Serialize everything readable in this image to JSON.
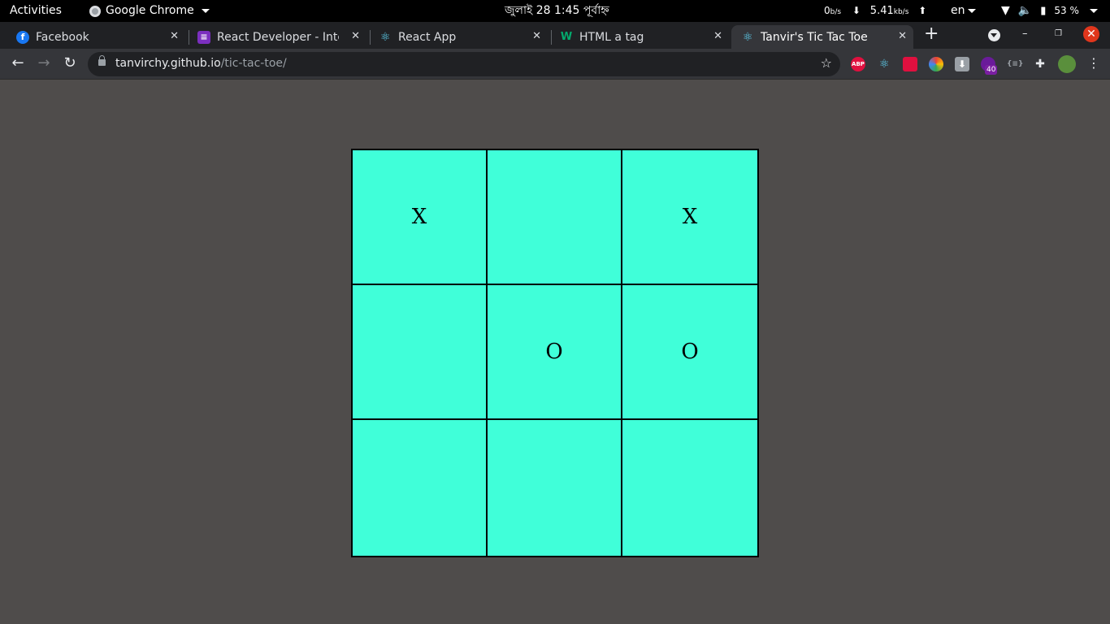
{
  "system_bar": {
    "activities": "Activities",
    "app_name": "Google Chrome",
    "clock": "জুলাই 28   1:45 পূর্বাহ্ন",
    "net_down_value": "0",
    "net_down_unit": "b/s",
    "net_up_value": "5.41",
    "net_up_unit": "kb/s",
    "language": "en",
    "battery": "53 %"
  },
  "tabs": [
    {
      "title": "Facebook",
      "icon": "facebook-icon",
      "color": "#1877f2"
    },
    {
      "title": "React Developer - Intern",
      "icon": "list-icon",
      "color": "#7b2fbf"
    },
    {
      "title": "React App",
      "icon": "react-icon",
      "color": "#61dafb"
    },
    {
      "title": "HTML a tag",
      "icon": "w3schools-icon",
      "color": "#04aa6d"
    },
    {
      "title": "Tanvir's Tic Tac Toe",
      "icon": "react-icon",
      "color": "#61dafb"
    }
  ],
  "address_bar": {
    "host": "tanvirchy.github.io",
    "path": "/tic-tac-toe/"
  },
  "extensions": {
    "adblock_label": "ABP",
    "badge_count": "40"
  },
  "board": {
    "cells": [
      "X",
      "",
      "X",
      "",
      "O",
      "O",
      "",
      "",
      ""
    ],
    "color": "#40ffd9"
  }
}
